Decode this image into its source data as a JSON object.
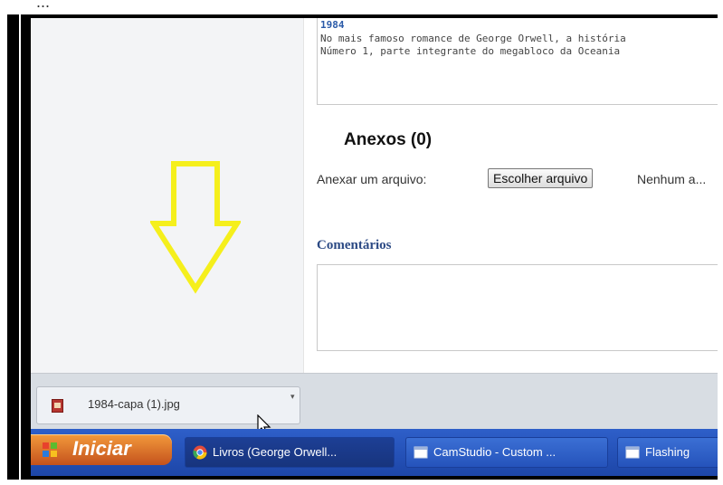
{
  "top_partial_text": "...",
  "book": {
    "title": "1984",
    "desc_line1": "No mais famoso romance de George Orwell, a história",
    "desc_line2": "Número 1, parte integrante do megabloco da Oceania"
  },
  "attachments": {
    "heading": "Anexos (0)",
    "attach_label": "Anexar um arquivo:",
    "choose_button": "Escolher arquivo",
    "no_file_text": "Nenhum a..."
  },
  "comments": {
    "heading": "Comentários"
  },
  "annotation": {
    "arrow_color": "#f5ef1c",
    "arrow_icon": "down-arrow-icon"
  },
  "download_bar": {
    "file_name": "1984-capa (1).jpg",
    "file_icon": "image-file-icon",
    "menu_icon": "chevron-down-icon"
  },
  "taskbar": {
    "start_label": "Iniciar",
    "tasks": [
      {
        "label": "Livros (George Orwell...",
        "icon": "chrome-icon"
      },
      {
        "label": "CamStudio - Custom ...",
        "icon": "window-icon"
      },
      {
        "label": "Flashing",
        "icon": "window-icon"
      }
    ]
  },
  "colors": {
    "accent_link": "#2a5aa8",
    "taskbar": "#2553bb",
    "start": "#e07a2c"
  }
}
